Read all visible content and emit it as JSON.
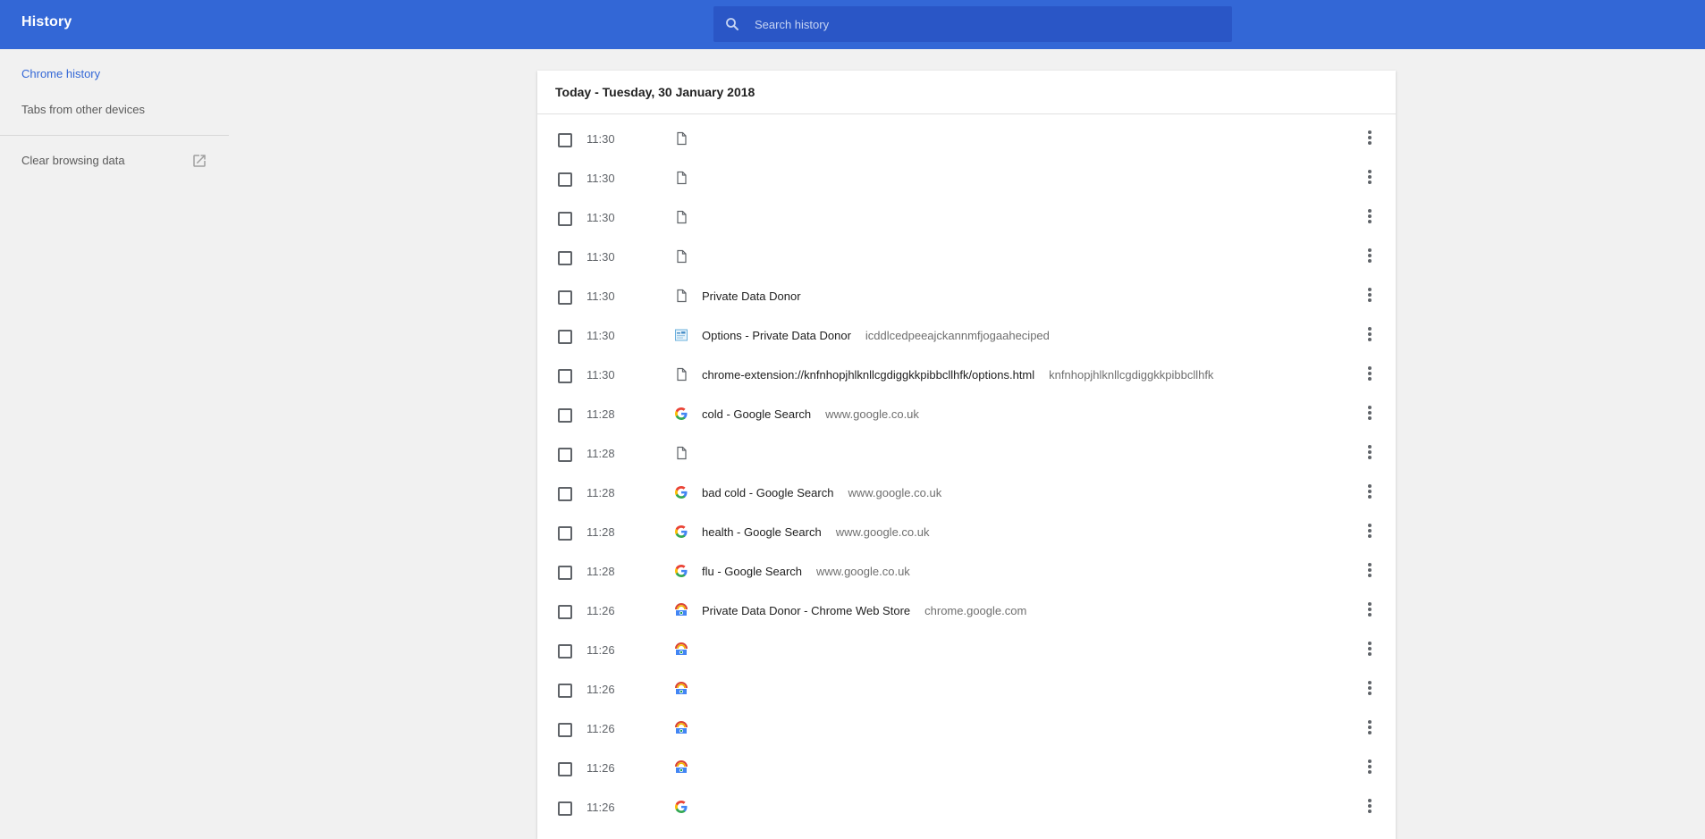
{
  "toolbar": {
    "title": "History",
    "search_placeholder": "Search history",
    "search_icon": "search-icon"
  },
  "sidebar": {
    "items": [
      {
        "label": "Chrome history",
        "selected": true
      },
      {
        "label": "Tabs from other devices",
        "selected": false
      }
    ],
    "clear_label": "Clear browsing data",
    "clear_icon": "open-in-new-icon"
  },
  "history": {
    "date_header": "Today - Tuesday, 30 January 2018",
    "rows": [
      {
        "time": "11:30",
        "icon": "page-icon",
        "title": "",
        "domain": ""
      },
      {
        "time": "11:30",
        "icon": "page-icon",
        "title": "",
        "domain": ""
      },
      {
        "time": "11:30",
        "icon": "page-icon",
        "title": "",
        "domain": ""
      },
      {
        "time": "11:30",
        "icon": "page-icon",
        "title": "",
        "domain": ""
      },
      {
        "time": "11:30",
        "icon": "page-icon",
        "title": "Private Data Donor",
        "domain": ""
      },
      {
        "time": "11:30",
        "icon": "extension-icon",
        "title": "Options - Private Data Donor",
        "domain": "icddlcedpeeajckannmfjogaaheciped"
      },
      {
        "time": "11:30",
        "icon": "page-icon",
        "title": "chrome-extension://knfnhopjhlknllcgdiggkkpibbcllhfk/options.html",
        "domain": "knfnhopjhlknllcgdiggkkpibbcllhfk"
      },
      {
        "time": "11:28",
        "icon": "google-icon",
        "title": "cold - Google Search",
        "domain": "www.google.co.uk"
      },
      {
        "time": "11:28",
        "icon": "page-icon",
        "title": "",
        "domain": ""
      },
      {
        "time": "11:28",
        "icon": "google-icon",
        "title": "bad cold - Google Search",
        "domain": "www.google.co.uk"
      },
      {
        "time": "11:28",
        "icon": "google-icon",
        "title": "health - Google Search",
        "domain": "www.google.co.uk"
      },
      {
        "time": "11:28",
        "icon": "google-icon",
        "title": "flu - Google Search",
        "domain": "www.google.co.uk"
      },
      {
        "time": "11:26",
        "icon": "web-store-icon",
        "title": "Private Data Donor - Chrome Web Store",
        "domain": "chrome.google.com"
      },
      {
        "time": "11:26",
        "icon": "web-store-icon",
        "title": "",
        "domain": ""
      },
      {
        "time": "11:26",
        "icon": "web-store-icon",
        "title": "",
        "domain": ""
      },
      {
        "time": "11:26",
        "icon": "web-store-icon",
        "title": "",
        "domain": ""
      },
      {
        "time": "11:26",
        "icon": "web-store-icon",
        "title": "",
        "domain": ""
      },
      {
        "time": "11:26",
        "icon": "google-icon",
        "title": "",
        "domain": ""
      }
    ]
  },
  "colors": {
    "toolbar": "#3367d6",
    "search_bg": "#2a56c6",
    "background": "#f1f1f1",
    "accent": "#3367d6"
  }
}
